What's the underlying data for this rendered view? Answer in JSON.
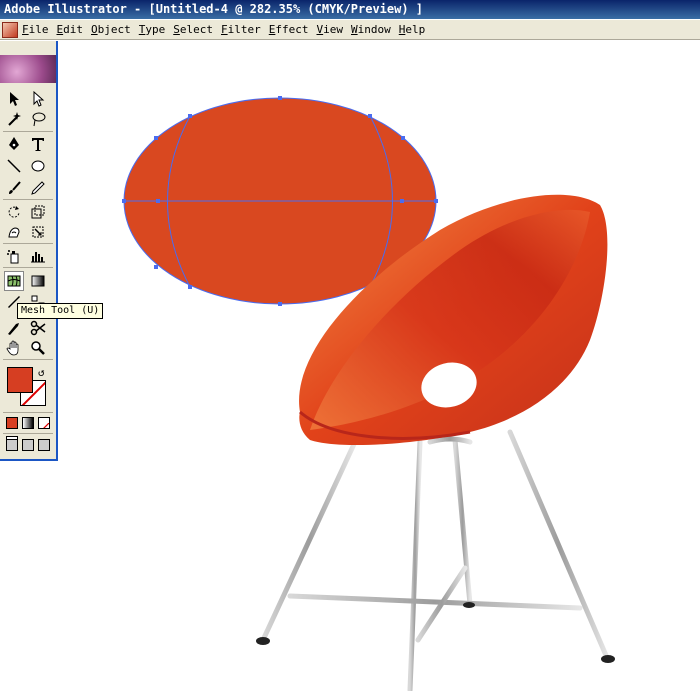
{
  "window": {
    "title": "Adobe Illustrator - [Untitled-4 @ 282.35% (CMYK/Preview) ]"
  },
  "menubar": {
    "items": [
      "File",
      "Edit",
      "Object",
      "Type",
      "Select",
      "Filter",
      "Effect",
      "View",
      "Window",
      "Help"
    ]
  },
  "toolbox": {
    "tooltip": "Mesh Tool (U)",
    "active_tool": "mesh-tool",
    "fill_color": "#d63e22",
    "stroke_color": "#ffffff"
  },
  "artwork": {
    "ellipse_fill": "#d94820",
    "selection_color": "#4a6cf0",
    "chair_color": "#e1421a",
    "leg_color": "#b0b0b0"
  }
}
